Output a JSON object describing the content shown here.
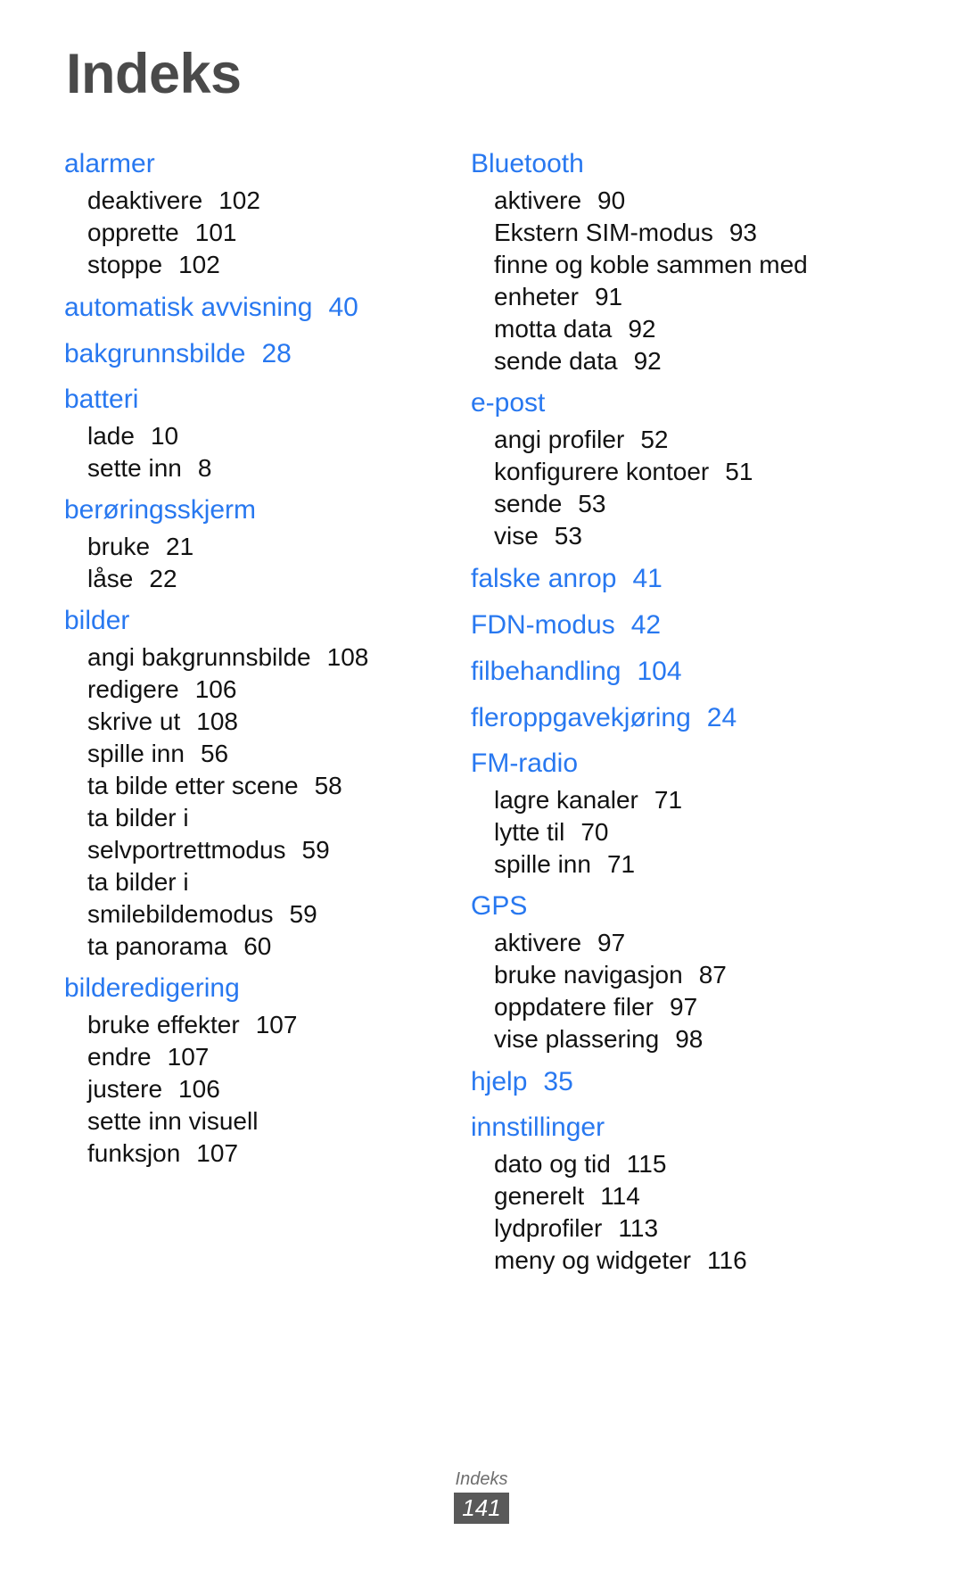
{
  "page": {
    "title": "Indeks",
    "accent_color": "#2878f0",
    "title_color": "#4a4a4a",
    "body_color": "#121212"
  },
  "columns": [
    {
      "id": "left",
      "groups": [
        {
          "head": "alarmer",
          "head_page": "",
          "entries": [
            {
              "label": "deaktivere",
              "page": "102"
            },
            {
              "label": "opprette",
              "page": "101"
            },
            {
              "label": "stoppe",
              "page": "102"
            }
          ]
        },
        {
          "head": "automatisk avvisning",
          "head_page": "40",
          "entries": []
        },
        {
          "head": "bakgrunnsbilde",
          "head_page": "28",
          "entries": []
        },
        {
          "head": "batteri",
          "head_page": "",
          "entries": [
            {
              "label": "lade",
              "page": "10"
            },
            {
              "label": "sette inn",
              "page": "8"
            }
          ]
        },
        {
          "head": "berøringsskjerm",
          "head_page": "",
          "entries": [
            {
              "label": "bruke",
              "page": "21"
            },
            {
              "label": "låse",
              "page": "22"
            }
          ]
        },
        {
          "head": "bilder",
          "head_page": "",
          "entries": [
            {
              "label": "angi bakgrunnsbilde",
              "page": "108"
            },
            {
              "label": "redigere",
              "page": "106"
            },
            {
              "label": "skrive ut",
              "page": "108"
            },
            {
              "label": "spille inn",
              "page": "56"
            },
            {
              "label": "ta bilde etter scene",
              "page": "58"
            },
            {
              "label": "ta bilder i",
              "page": ""
            },
            {
              "label": "selvportrettmodus",
              "page": "59"
            },
            {
              "label": "ta bilder i",
              "page": ""
            },
            {
              "label": "smilebildemodus",
              "page": "59"
            },
            {
              "label": "ta panorama",
              "page": "60"
            }
          ]
        },
        {
          "head": "bilderedigering",
          "head_page": "",
          "entries": [
            {
              "label": "bruke effekter",
              "page": "107"
            },
            {
              "label": "endre",
              "page": "107"
            },
            {
              "label": "justere",
              "page": "106"
            },
            {
              "label": "sette inn visuell",
              "page": ""
            },
            {
              "label": "funksjon",
              "page": "107"
            }
          ]
        }
      ]
    },
    {
      "id": "right",
      "groups": [
        {
          "head": "Bluetooth",
          "head_page": "",
          "entries": [
            {
              "label": "aktivere",
              "page": "90"
            },
            {
              "label": "Ekstern SIM-modus",
              "page": "93"
            },
            {
              "label": "finne og koble sammen med",
              "page": ""
            },
            {
              "label": "enheter",
              "page": "91"
            },
            {
              "label": "motta data",
              "page": "92"
            },
            {
              "label": "sende data",
              "page": "92"
            }
          ]
        },
        {
          "head": "e-post",
          "head_page": "",
          "entries": [
            {
              "label": "angi profiler",
              "page": "52"
            },
            {
              "label": "konfigurere kontoer",
              "page": "51"
            },
            {
              "label": "sende",
              "page": "53"
            },
            {
              "label": "vise",
              "page": "53"
            }
          ]
        },
        {
          "head": "falske anrop",
          "head_page": "41",
          "entries": []
        },
        {
          "head": "FDN-modus",
          "head_page": "42",
          "entries": []
        },
        {
          "head": "filbehandling",
          "head_page": "104",
          "entries": []
        },
        {
          "head": "fleroppgavekjøring",
          "head_page": "24",
          "entries": []
        },
        {
          "head": "FM-radio",
          "head_page": "",
          "entries": [
            {
              "label": "lagre kanaler",
              "page": "71"
            },
            {
              "label": "lytte til",
              "page": "70"
            },
            {
              "label": "spille inn",
              "page": "71"
            }
          ]
        },
        {
          "head": "GPS",
          "head_page": "",
          "entries": [
            {
              "label": "aktivere",
              "page": "97"
            },
            {
              "label": "bruke navigasjon",
              "page": "87"
            },
            {
              "label": "oppdatere filer",
              "page": "97"
            },
            {
              "label": "vise plassering",
              "page": "98"
            }
          ]
        },
        {
          "head": "hjelp",
          "head_page": "35",
          "entries": []
        },
        {
          "head": "innstillinger",
          "head_page": "",
          "entries": [
            {
              "label": "dato og tid",
              "page": "115"
            },
            {
              "label": "generelt",
              "page": "114"
            },
            {
              "label": "lydprofiler",
              "page": "113"
            },
            {
              "label": "meny og widgeter",
              "page": "116"
            }
          ]
        }
      ]
    }
  ],
  "footer": {
    "label": "Indeks",
    "page_number": "141"
  }
}
